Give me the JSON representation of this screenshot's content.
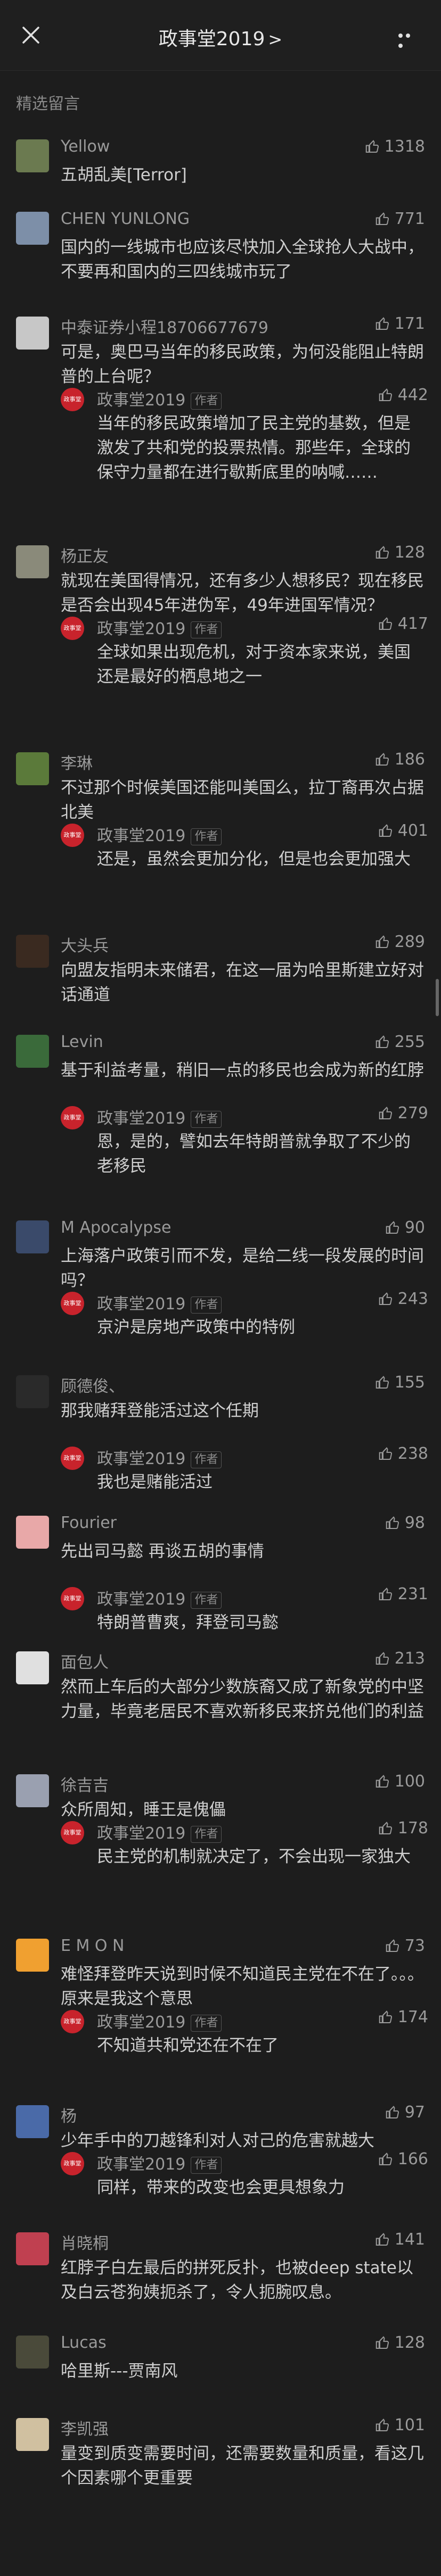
{
  "header": {
    "title": "政事堂2019",
    "chevron": ">"
  },
  "section_label": "精选留言",
  "author_badge": "作者",
  "comments": [
    {
      "name": "Yellow",
      "likes": "1318",
      "text": "五胡乱美[Terror]",
      "avatar_color": "#6b7a50"
    },
    {
      "name": "CHEN YUNLONG",
      "likes": "771",
      "text": "国内的一线城市也应该尽快加入全球抢人大战中，不要再和国内的三四线城市玩了",
      "avatar_color": "#7d8fa8"
    },
    {
      "name": "中泰证券小程18706677679",
      "likes": "171",
      "text": "可是，奥巴马当年的移民政策，为何没能阻止特朗普的上台呢？",
      "avatar_color": "#c7c7c7",
      "reply": {
        "name": "政事堂2019",
        "likes": "442",
        "text": "当年的移民政策增加了民主党的基数，但是激发了共和党的投票热情。那些年，全球的保守力量都在进行歇斯底里的呐喊……"
      }
    },
    {
      "name": "杨正友",
      "likes": "128",
      "text": "就现在美国得情况，还有多少人想移民？现在移民是否会出现45年进伪军，49年进国军情况？",
      "avatar_color": "#8a8a7a",
      "reply": {
        "name": "政事堂2019",
        "likes": "417",
        "text": "全球如果出现危机，对于资本家来说，美国还是最好的栖息地之一"
      }
    },
    {
      "name": "李琳",
      "likes": "186",
      "text": "不过那个时候美国还能叫美国么，拉丁裔再次占据北美",
      "avatar_color": "#5b7a3a",
      "reply": {
        "name": "政事堂2019",
        "likes": "401",
        "text": "还是，虽然会更加分化，但是也会更加强大"
      }
    },
    {
      "name": "大头兵",
      "likes": "289",
      "text": "向盟友指明未来储君，在这一届为哈里斯建立好对话通道",
      "avatar_color": "#3a2a20"
    },
    {
      "name": "Levin",
      "likes": "255",
      "text": "基于利益考量，稍旧一点的移民也会成为新的红脖",
      "avatar_color": "#3a6a3a",
      "reply": {
        "name": "政事堂2019",
        "likes": "279",
        "text": "恩，是的，譬如去年特朗普就争取了不少的老移民"
      }
    },
    {
      "name": "M Apocalypse",
      "likes": "90",
      "text": "上海落户政策引而不发，是给二线一段发展的时间吗？",
      "avatar_color": "#3a4a6a",
      "reply": {
        "name": "政事堂2019",
        "likes": "243",
        "text": "京沪是房地产政策中的特例"
      }
    },
    {
      "name": "顾德俊、",
      "likes": "155",
      "text": "那我赌拜登能活过这个任期",
      "avatar_color": "#2a2a2a",
      "reply": {
        "name": "政事堂2019",
        "likes": "238",
        "text": "我也是赌能活过"
      }
    },
    {
      "name": "Fourier",
      "likes": "98",
      "text": "先出司马懿 再谈五胡的事情",
      "avatar_color": "#e8a8a8",
      "reply": {
        "name": "政事堂2019",
        "likes": "231",
        "text": "特朗普曹爽，拜登司马懿"
      }
    },
    {
      "name": "面包人",
      "likes": "213",
      "text": "然而上车后的大部分少数族裔又成了新象党的中坚力量，毕竟老居民不喜欢新移民来挤兑他们的利益",
      "avatar_color": "#e0e0e0"
    },
    {
      "name": "徐吉吉",
      "likes": "100",
      "text": "众所周知，睡王是傀儡",
      "avatar_color": "#9aa0b0",
      "reply": {
        "name": "政事堂2019",
        "likes": "178",
        "text": "民主党的机制就决定了，不会出现一家独大"
      }
    },
    {
      "name": "E  M  O  N",
      "likes": "73",
      "text": "难怪拜登昨天说到时候不知道民主党在不在了。。。原来是我这个意思",
      "avatar_color": "#f0a030",
      "reply": {
        "name": "政事堂2019",
        "likes": "174",
        "text": "不知道共和党还在不在了"
      }
    },
    {
      "name": "杨",
      "likes": "97",
      "text": "少年手中的刀越锋利对人对己的危害就越大",
      "avatar_color": "#4a6aa8",
      "reply": {
        "name": "政事堂2019",
        "likes": "166",
        "text": "同样，带来的改变也会更具想象力"
      }
    },
    {
      "name": "肖晓桐",
      "likes": "141",
      "text": "红脖子白左最后的拼死反扑，也被deep state以及白云苍狗姨扼杀了，令人扼腕叹息。",
      "avatar_color": "#c04050"
    },
    {
      "name": "Lucas",
      "likes": "128",
      "text": "哈里斯---贾南风",
      "avatar_color": "#4a4a3a"
    },
    {
      "name": "李凯强",
      "likes": "101",
      "text": "量变到质变需要时间，还需要数量和质量，看这几个因素哪个更重要",
      "avatar_color": "#d0c0a0"
    }
  ],
  "colors": {
    "background": "#1d1d1d",
    "reply_avatar": "#c8232c"
  },
  "icons": {
    "close": "close-icon",
    "more": "more-icon",
    "like": "thumb-up-icon"
  }
}
